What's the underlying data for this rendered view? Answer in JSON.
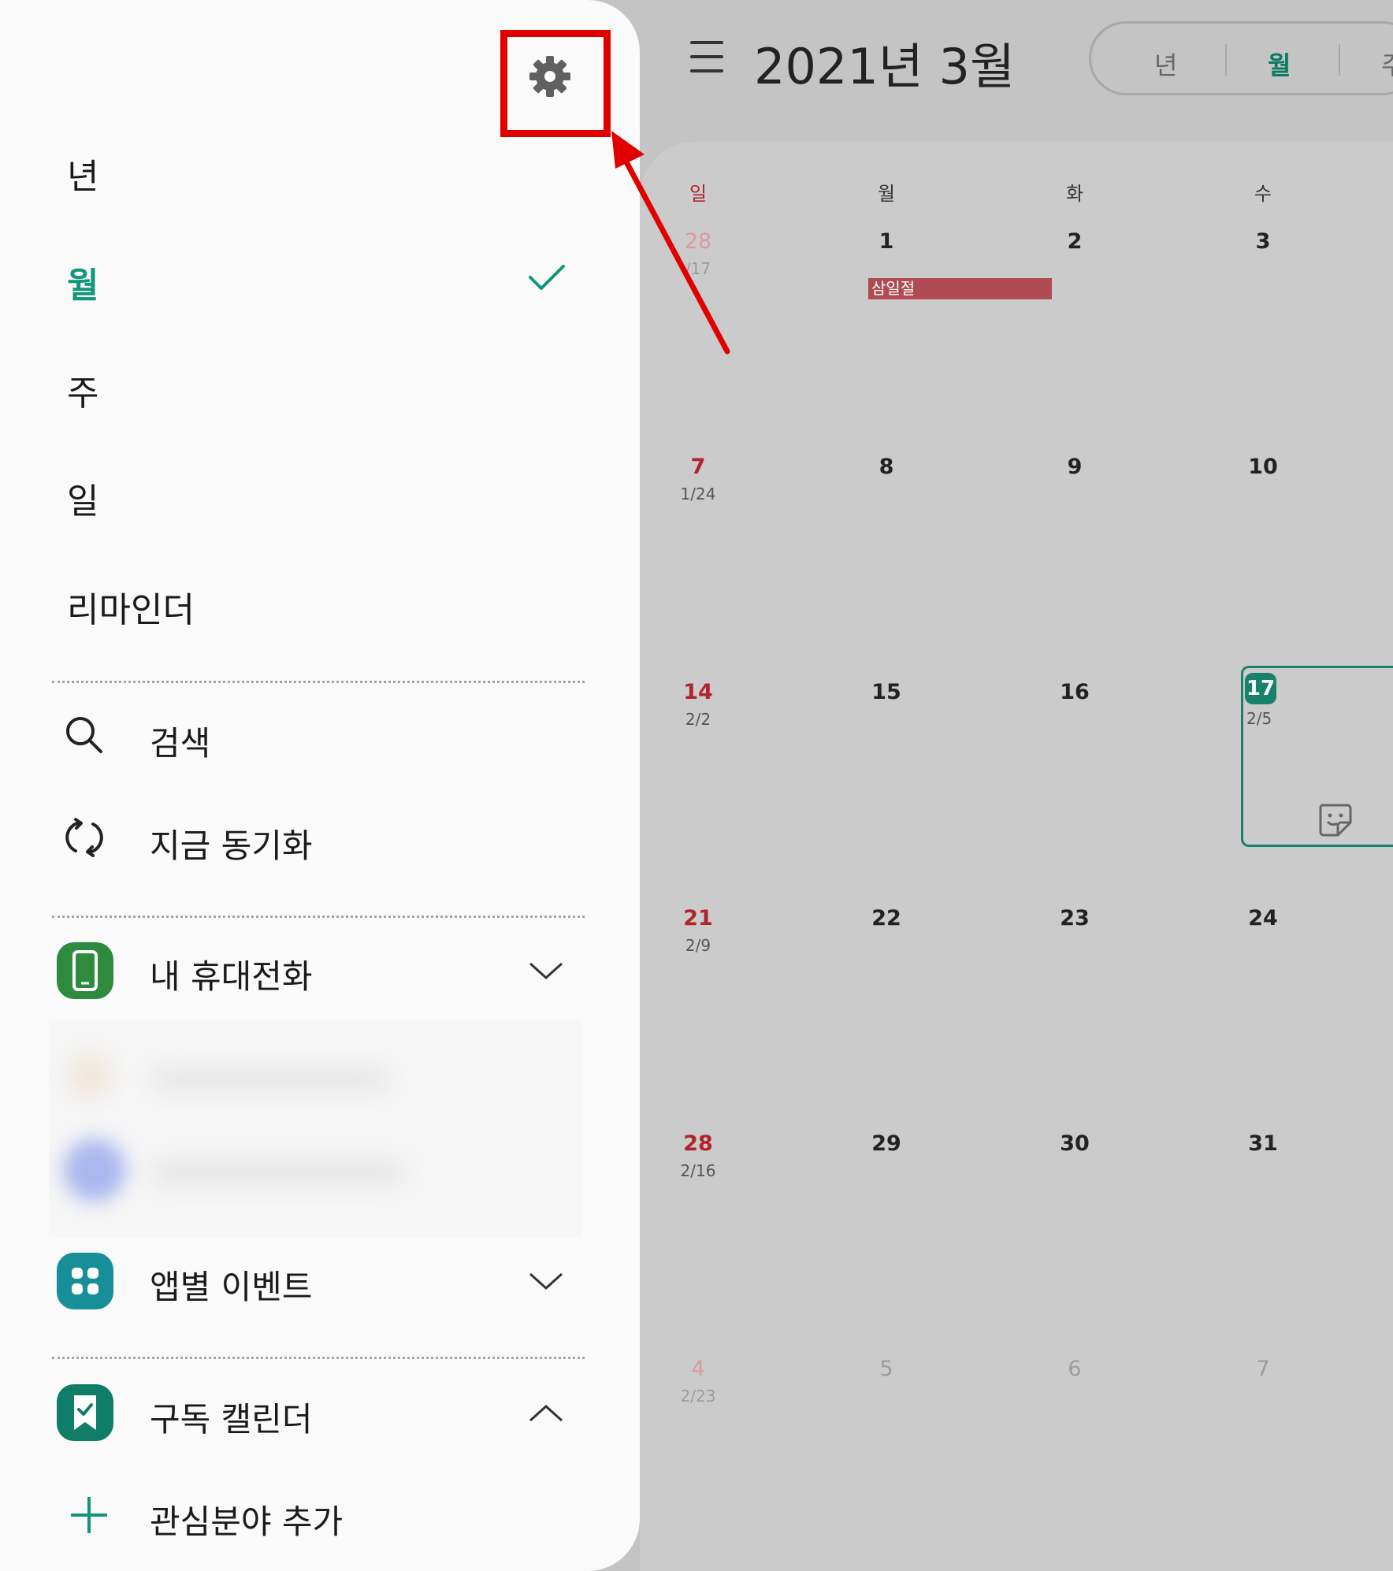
{
  "calendar": {
    "title": "2021년 3월",
    "view_switch": [
      "년",
      "월",
      "주"
    ],
    "active_view": "월",
    "weekdays": [
      "일",
      "월",
      "화",
      "수"
    ],
    "weeks": [
      [
        {
          "day": "28",
          "lunar": "/17",
          "dim": true
        },
        {
          "day": "1"
        },
        {
          "day": "2"
        },
        {
          "day": "3"
        }
      ],
      [
        {
          "day": "7",
          "lunar": "1/24"
        },
        {
          "day": "8"
        },
        {
          "day": "9"
        },
        {
          "day": "10"
        }
      ],
      [
        {
          "day": "14",
          "lunar": "2/2"
        },
        {
          "day": "15"
        },
        {
          "day": "16"
        },
        {
          "day": "17",
          "lunar": "2/5",
          "today": true
        }
      ],
      [
        {
          "day": "21",
          "lunar": "2/9"
        },
        {
          "day": "22"
        },
        {
          "day": "23"
        },
        {
          "day": "24"
        }
      ],
      [
        {
          "day": "28",
          "lunar": "2/16"
        },
        {
          "day": "29"
        },
        {
          "day": "30"
        },
        {
          "day": "31"
        }
      ],
      [
        {
          "day": "4",
          "lunar": "2/23",
          "dim": true
        },
        {
          "day": "5",
          "dim": true
        },
        {
          "day": "6",
          "dim": true
        },
        {
          "day": "7",
          "dim": true
        }
      ]
    ],
    "holiday_event": "삼일절",
    "colors": {
      "accent": "#12967a",
      "sunday": "#b3232e",
      "holiday": "#b04b54",
      "annotation": "#e00000"
    }
  },
  "drawer": {
    "views": [
      {
        "label": "년"
      },
      {
        "label": "월",
        "active": true
      },
      {
        "label": "주"
      },
      {
        "label": "일"
      },
      {
        "label": "리마인더"
      }
    ],
    "search_label": "검색",
    "sync_label": "지금 동기화",
    "my_phone_label": "내 휴대전화",
    "app_events_label": "앱별 이벤트",
    "subscribed_label": "구독 캘린더",
    "add_interest_label": "관심분야 추가",
    "icons": [
      "gear-icon",
      "check-icon",
      "search-icon",
      "sync-icon",
      "phone-app-icon",
      "apps-icon",
      "bookmark-calendar-icon",
      "plus-icon",
      "chevron-down-icon",
      "chevron-up-icon",
      "menu-icon",
      "sticker-icon"
    ]
  }
}
